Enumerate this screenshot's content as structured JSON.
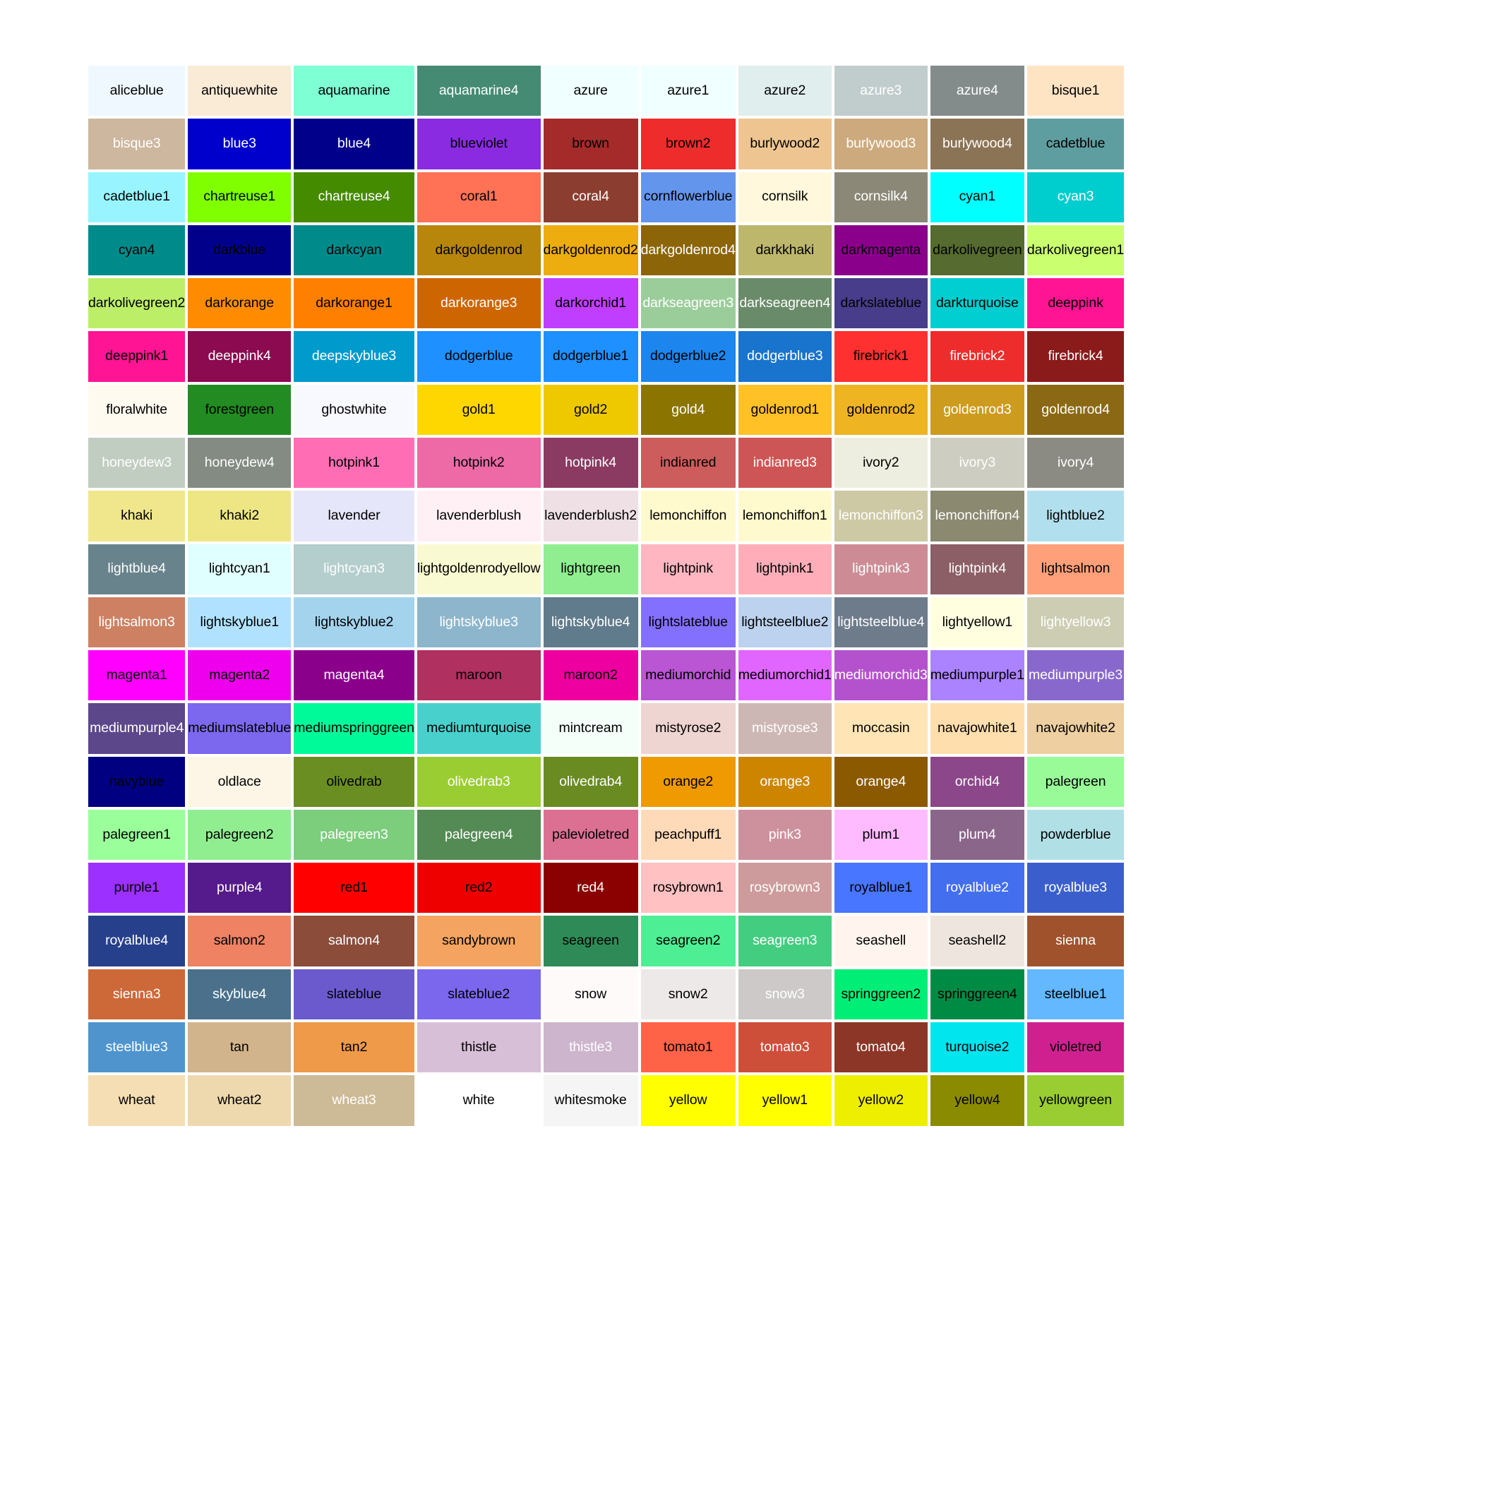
{
  "figure": {
    "type": "color-swatch-grid",
    "background": "#ffffff",
    "columns": 10,
    "rows": 25,
    "total_swatches": 250,
    "gap_color": "#ffffff"
  },
  "chart_data": {
    "type": "table",
    "title": "",
    "xlabel": "",
    "ylabel": "",
    "columns": 10,
    "rows": 25,
    "swatches": [
      {
        "name": "aliceblue",
        "hex": "#f0f8ff",
        "text": "#000000"
      },
      {
        "name": "antiquewhite",
        "hex": "#faebd7",
        "text": "#000000"
      },
      {
        "name": "aquamarine",
        "hex": "#7fffd4",
        "text": "#000000"
      },
      {
        "name": "aquamarine4",
        "hex": "#458b74",
        "text": "#ffffff"
      },
      {
        "name": "azure",
        "hex": "#f0ffff",
        "text": "#000000"
      },
      {
        "name": "azure1",
        "hex": "#f0ffff",
        "text": "#000000"
      },
      {
        "name": "azure2",
        "hex": "#e0eeee",
        "text": "#000000"
      },
      {
        "name": "azure3",
        "hex": "#c1cdcd",
        "text": "#ffffff"
      },
      {
        "name": "azure4",
        "hex": "#838b8b",
        "text": "#ffffff"
      },
      {
        "name": "bisque1",
        "hex": "#ffe4c4",
        "text": "#000000"
      },
      {
        "name": "bisque3",
        "hex": "#cdb79e",
        "text": "#ffffff"
      },
      {
        "name": "blue3",
        "hex": "#0000cd",
        "text": "#ffffff"
      },
      {
        "name": "blue4",
        "hex": "#00008b",
        "text": "#ffffff"
      },
      {
        "name": "blueviolet",
        "hex": "#8a2be2",
        "text": "#000000"
      },
      {
        "name": "brown",
        "hex": "#a52a2a",
        "text": "#000000"
      },
      {
        "name": "brown2",
        "hex": "#ee2c2c",
        "text": "#000000"
      },
      {
        "name": "burlywood2",
        "hex": "#eec591",
        "text": "#000000"
      },
      {
        "name": "burlywood3",
        "hex": "#cdaa7d",
        "text": "#ffffff"
      },
      {
        "name": "burlywood4",
        "hex": "#8b7355",
        "text": "#ffffff"
      },
      {
        "name": "cadetblue",
        "hex": "#5f9ea0",
        "text": "#000000"
      },
      {
        "name": "cadetblue1",
        "hex": "#98f5ff",
        "text": "#000000"
      },
      {
        "name": "chartreuse1",
        "hex": "#7fff00",
        "text": "#000000"
      },
      {
        "name": "chartreuse4",
        "hex": "#458b00",
        "text": "#ffffff"
      },
      {
        "name": "coral1",
        "hex": "#ff7256",
        "text": "#000000"
      },
      {
        "name": "coral4",
        "hex": "#8b3e2f",
        "text": "#ffffff"
      },
      {
        "name": "cornflowerblue",
        "hex": "#6495ed",
        "text": "#000000"
      },
      {
        "name": "cornsilk",
        "hex": "#fff8dc",
        "text": "#000000"
      },
      {
        "name": "cornsilk4",
        "hex": "#8b8878",
        "text": "#ffffff"
      },
      {
        "name": "cyan1",
        "hex": "#00ffff",
        "text": "#000000"
      },
      {
        "name": "cyan3",
        "hex": "#00cdcd",
        "text": "#ffffff"
      },
      {
        "name": "cyan4",
        "hex": "#008b8b",
        "text": "#000000"
      },
      {
        "name": "darkblue",
        "hex": "#00008b",
        "text": "#000000"
      },
      {
        "name": "darkcyan",
        "hex": "#008b8b",
        "text": "#000000"
      },
      {
        "name": "darkgoldenrod",
        "hex": "#b8860b",
        "text": "#000000"
      },
      {
        "name": "darkgoldenrod2",
        "hex": "#eead0e",
        "text": "#000000"
      },
      {
        "name": "darkgoldenrod4",
        "hex": "#8b6508",
        "text": "#ffffff"
      },
      {
        "name": "darkkhaki",
        "hex": "#bdb76b",
        "text": "#000000"
      },
      {
        "name": "darkmagenta",
        "hex": "#8b008b",
        "text": "#000000"
      },
      {
        "name": "darkolivegreen",
        "hex": "#556b2f",
        "text": "#000000"
      },
      {
        "name": "darkolivegreen1",
        "hex": "#caff70",
        "text": "#000000"
      },
      {
        "name": "darkolivegreen2",
        "hex": "#bcee68",
        "text": "#000000"
      },
      {
        "name": "darkorange",
        "hex": "#ff8c00",
        "text": "#000000"
      },
      {
        "name": "darkorange1",
        "hex": "#ff7f00",
        "text": "#000000"
      },
      {
        "name": "darkorange3",
        "hex": "#cd6600",
        "text": "#ffffff"
      },
      {
        "name": "darkorchid1",
        "hex": "#bf3eff",
        "text": "#000000"
      },
      {
        "name": "darkseagreen3",
        "hex": "#9bcd9b",
        "text": "#ffffff"
      },
      {
        "name": "darkseagreen4",
        "hex": "#698b69",
        "text": "#ffffff"
      },
      {
        "name": "darkslateblue",
        "hex": "#483d8b",
        "text": "#000000"
      },
      {
        "name": "darkturquoise",
        "hex": "#00ced1",
        "text": "#000000"
      },
      {
        "name": "deeppink",
        "hex": "#ff1493",
        "text": "#000000"
      },
      {
        "name": "deeppink1",
        "hex": "#ff1493",
        "text": "#000000"
      },
      {
        "name": "deeppink4",
        "hex": "#8b0a50",
        "text": "#ffffff"
      },
      {
        "name": "deepskyblue3",
        "hex": "#009acd",
        "text": "#ffffff"
      },
      {
        "name": "dodgerblue",
        "hex": "#1e90ff",
        "text": "#000000"
      },
      {
        "name": "dodgerblue1",
        "hex": "#1e90ff",
        "text": "#000000"
      },
      {
        "name": "dodgerblue2",
        "hex": "#1c86ee",
        "text": "#000000"
      },
      {
        "name": "dodgerblue3",
        "hex": "#1874cd",
        "text": "#ffffff"
      },
      {
        "name": "firebrick1",
        "hex": "#ff3030",
        "text": "#000000"
      },
      {
        "name": "firebrick2",
        "hex": "#ee2c2c",
        "text": "#ffffff"
      },
      {
        "name": "firebrick4",
        "hex": "#8b1a1a",
        "text": "#ffffff"
      },
      {
        "name": "floralwhite",
        "hex": "#fffaf0",
        "text": "#000000"
      },
      {
        "name": "forestgreen",
        "hex": "#228b22",
        "text": "#000000"
      },
      {
        "name": "ghostwhite",
        "hex": "#f8f8ff",
        "text": "#000000"
      },
      {
        "name": "gold1",
        "hex": "#ffd700",
        "text": "#000000"
      },
      {
        "name": "gold2",
        "hex": "#eec900",
        "text": "#000000"
      },
      {
        "name": "gold4",
        "hex": "#8b7500",
        "text": "#ffffff"
      },
      {
        "name": "goldenrod1",
        "hex": "#ffc125",
        "text": "#000000"
      },
      {
        "name": "goldenrod2",
        "hex": "#eeb422",
        "text": "#000000"
      },
      {
        "name": "goldenrod3",
        "hex": "#cd9b1d",
        "text": "#ffffff"
      },
      {
        "name": "goldenrod4",
        "hex": "#8b6914",
        "text": "#ffffff"
      },
      {
        "name": "honeydew3",
        "hex": "#c1cdc1",
        "text": "#ffffff"
      },
      {
        "name": "honeydew4",
        "hex": "#838b83",
        "text": "#ffffff"
      },
      {
        "name": "hotpink1",
        "hex": "#ff6eb4",
        "text": "#000000"
      },
      {
        "name": "hotpink2",
        "hex": "#ee6aa7",
        "text": "#000000"
      },
      {
        "name": "hotpink4",
        "hex": "#8b3a62",
        "text": "#ffffff"
      },
      {
        "name": "indianred",
        "hex": "#cd5c5c",
        "text": "#000000"
      },
      {
        "name": "indianred3",
        "hex": "#cd5555",
        "text": "#ffffff"
      },
      {
        "name": "ivory2",
        "hex": "#eeeee0",
        "text": "#000000"
      },
      {
        "name": "ivory3",
        "hex": "#cdcdc1",
        "text": "#ffffff"
      },
      {
        "name": "ivory4",
        "hex": "#8b8b83",
        "text": "#ffffff"
      },
      {
        "name": "khaki",
        "hex": "#f0e68c",
        "text": "#000000"
      },
      {
        "name": "khaki2",
        "hex": "#eee685",
        "text": "#000000"
      },
      {
        "name": "lavender",
        "hex": "#e6e6fa",
        "text": "#000000"
      },
      {
        "name": "lavenderblush",
        "hex": "#fff0f5",
        "text": "#000000"
      },
      {
        "name": "lavenderblush2",
        "hex": "#eee0e5",
        "text": "#000000"
      },
      {
        "name": "lemonchiffon",
        "hex": "#fffacd",
        "text": "#000000"
      },
      {
        "name": "lemonchiffon1",
        "hex": "#fffacd",
        "text": "#000000"
      },
      {
        "name": "lemonchiffon3",
        "hex": "#cdc9a5",
        "text": "#ffffff"
      },
      {
        "name": "lemonchiffon4",
        "hex": "#8b8970",
        "text": "#ffffff"
      },
      {
        "name": "lightblue2",
        "hex": "#b2dfee",
        "text": "#000000"
      },
      {
        "name": "lightblue4",
        "hex": "#68838b",
        "text": "#ffffff"
      },
      {
        "name": "lightcyan1",
        "hex": "#e0ffff",
        "text": "#000000"
      },
      {
        "name": "lightcyan3",
        "hex": "#b4cdcd",
        "text": "#ffffff"
      },
      {
        "name": "lightgoldenrodyellow",
        "hex": "#fafad2",
        "text": "#000000"
      },
      {
        "name": "lightgreen",
        "hex": "#90ee90",
        "text": "#000000"
      },
      {
        "name": "lightpink",
        "hex": "#ffb6c1",
        "text": "#000000"
      },
      {
        "name": "lightpink1",
        "hex": "#ffaeb9",
        "text": "#000000"
      },
      {
        "name": "lightpink3",
        "hex": "#cd8c95",
        "text": "#ffffff"
      },
      {
        "name": "lightpink4",
        "hex": "#8b5f65",
        "text": "#ffffff"
      },
      {
        "name": "lightsalmon",
        "hex": "#ffa07a",
        "text": "#000000"
      },
      {
        "name": "lightsalmon3",
        "hex": "#cd8162",
        "text": "#ffffff"
      },
      {
        "name": "lightskyblue1",
        "hex": "#b0e2ff",
        "text": "#000000"
      },
      {
        "name": "lightskyblue2",
        "hex": "#a4d3ee",
        "text": "#000000"
      },
      {
        "name": "lightskyblue3",
        "hex": "#8db6cd",
        "text": "#ffffff"
      },
      {
        "name": "lightskyblue4",
        "hex": "#607b8b",
        "text": "#ffffff"
      },
      {
        "name": "lightslateblue",
        "hex": "#8470ff",
        "text": "#000000"
      },
      {
        "name": "lightsteelblue2",
        "hex": "#bcd2ee",
        "text": "#000000"
      },
      {
        "name": "lightsteelblue4",
        "hex": "#6e7b8b",
        "text": "#ffffff"
      },
      {
        "name": "lightyellow1",
        "hex": "#ffffe0",
        "text": "#000000"
      },
      {
        "name": "lightyellow3",
        "hex": "#cdcdb4",
        "text": "#ffffff"
      },
      {
        "name": "magenta1",
        "hex": "#ff00ff",
        "text": "#000000"
      },
      {
        "name": "magenta2",
        "hex": "#ee00ee",
        "text": "#000000"
      },
      {
        "name": "magenta4",
        "hex": "#8b008b",
        "text": "#ffffff"
      },
      {
        "name": "maroon",
        "hex": "#b03060",
        "text": "#000000"
      },
      {
        "name": "maroon2",
        "hex": "#ee00a0",
        "text": "#000000"
      },
      {
        "name": "mediumorchid",
        "hex": "#ba55d3",
        "text": "#000000"
      },
      {
        "name": "mediumorchid1",
        "hex": "#e066ff",
        "text": "#000000"
      },
      {
        "name": "mediumorchid3",
        "hex": "#b452cd",
        "text": "#ffffff"
      },
      {
        "name": "mediumpurple1",
        "hex": "#ab82ff",
        "text": "#000000"
      },
      {
        "name": "mediumpurple3",
        "hex": "#8968cd",
        "text": "#ffffff"
      },
      {
        "name": "mediumpurple4",
        "hex": "#5d478b",
        "text": "#ffffff"
      },
      {
        "name": "mediumslateblue",
        "hex": "#7b68ee",
        "text": "#000000"
      },
      {
        "name": "mediumspringgreen",
        "hex": "#00fa9a",
        "text": "#000000"
      },
      {
        "name": "mediumturquoise",
        "hex": "#48d1cc",
        "text": "#000000"
      },
      {
        "name": "mintcream",
        "hex": "#f5fffa",
        "text": "#000000"
      },
      {
        "name": "mistyrose2",
        "hex": "#eed5d2",
        "text": "#000000"
      },
      {
        "name": "mistyrose3",
        "hex": "#cdb7b5",
        "text": "#ffffff"
      },
      {
        "name": "moccasin",
        "hex": "#ffe4b5",
        "text": "#000000"
      },
      {
        "name": "navajowhite1",
        "hex": "#ffdead",
        "text": "#000000"
      },
      {
        "name": "navajowhite2",
        "hex": "#eecfa1",
        "text": "#000000"
      },
      {
        "name": "navyblue",
        "hex": "#000080",
        "text": "#000000"
      },
      {
        "name": "oldlace",
        "hex": "#fdf5e6",
        "text": "#000000"
      },
      {
        "name": "olivedrab",
        "hex": "#6b8e23",
        "text": "#000000"
      },
      {
        "name": "olivedrab3",
        "hex": "#9acd32",
        "text": "#ffffff"
      },
      {
        "name": "olivedrab4",
        "hex": "#698b22",
        "text": "#ffffff"
      },
      {
        "name": "orange2",
        "hex": "#ee9a00",
        "text": "#000000"
      },
      {
        "name": "orange3",
        "hex": "#cd8500",
        "text": "#ffffff"
      },
      {
        "name": "orange4",
        "hex": "#8b5a00",
        "text": "#ffffff"
      },
      {
        "name": "orchid4",
        "hex": "#8b4789",
        "text": "#ffffff"
      },
      {
        "name": "palegreen",
        "hex": "#98fb98",
        "text": "#000000"
      },
      {
        "name": "palegreen1",
        "hex": "#9aff9a",
        "text": "#000000"
      },
      {
        "name": "palegreen2",
        "hex": "#90ee90",
        "text": "#000000"
      },
      {
        "name": "palegreen3",
        "hex": "#7ccd7c",
        "text": "#ffffff"
      },
      {
        "name": "palegreen4",
        "hex": "#548b54",
        "text": "#ffffff"
      },
      {
        "name": "palevioletred",
        "hex": "#db7093",
        "text": "#000000"
      },
      {
        "name": "peachpuff1",
        "hex": "#ffdab9",
        "text": "#000000"
      },
      {
        "name": "pink3",
        "hex": "#cd919e",
        "text": "#ffffff"
      },
      {
        "name": "plum1",
        "hex": "#ffbbff",
        "text": "#000000"
      },
      {
        "name": "plum4",
        "hex": "#8b668b",
        "text": "#ffffff"
      },
      {
        "name": "powderblue",
        "hex": "#b0e0e6",
        "text": "#000000"
      },
      {
        "name": "purple1",
        "hex": "#9b30ff",
        "text": "#000000"
      },
      {
        "name": "purple4",
        "hex": "#551a8b",
        "text": "#ffffff"
      },
      {
        "name": "red1",
        "hex": "#ff0000",
        "text": "#000000"
      },
      {
        "name": "red2",
        "hex": "#ee0000",
        "text": "#000000"
      },
      {
        "name": "red4",
        "hex": "#8b0000",
        "text": "#ffffff"
      },
      {
        "name": "rosybrown1",
        "hex": "#ffc1c1",
        "text": "#000000"
      },
      {
        "name": "rosybrown3",
        "hex": "#cd9b9b",
        "text": "#ffffff"
      },
      {
        "name": "royalblue1",
        "hex": "#4876ff",
        "text": "#000000"
      },
      {
        "name": "royalblue2",
        "hex": "#436eee",
        "text": "#ffffff"
      },
      {
        "name": "royalblue3",
        "hex": "#3a5fcd",
        "text": "#ffffff"
      },
      {
        "name": "royalblue4",
        "hex": "#27408b",
        "text": "#ffffff"
      },
      {
        "name": "salmon2",
        "hex": "#ee8262",
        "text": "#000000"
      },
      {
        "name": "salmon4",
        "hex": "#8b4c39",
        "text": "#ffffff"
      },
      {
        "name": "sandybrown",
        "hex": "#f4a460",
        "text": "#000000"
      },
      {
        "name": "seagreen",
        "hex": "#2e8b57",
        "text": "#000000"
      },
      {
        "name": "seagreen2",
        "hex": "#4eee94",
        "text": "#000000"
      },
      {
        "name": "seagreen3",
        "hex": "#43cd80",
        "text": "#ffffff"
      },
      {
        "name": "seashell",
        "hex": "#fff5ee",
        "text": "#000000"
      },
      {
        "name": "seashell2",
        "hex": "#eee5de",
        "text": "#000000"
      },
      {
        "name": "sienna",
        "hex": "#a0522d",
        "text": "#ffffff"
      },
      {
        "name": "sienna3",
        "hex": "#cd6839",
        "text": "#ffffff"
      },
      {
        "name": "skyblue4",
        "hex": "#4a708b",
        "text": "#ffffff"
      },
      {
        "name": "slateblue",
        "hex": "#6a5acd",
        "text": "#000000"
      },
      {
        "name": "slateblue2",
        "hex": "#7a67ee",
        "text": "#000000"
      },
      {
        "name": "snow",
        "hex": "#fffafa",
        "text": "#000000"
      },
      {
        "name": "snow2",
        "hex": "#eee9e9",
        "text": "#000000"
      },
      {
        "name": "snow3",
        "hex": "#cdc9c9",
        "text": "#ffffff"
      },
      {
        "name": "springgreen2",
        "hex": "#00ee76",
        "text": "#000000"
      },
      {
        "name": "springgreen4",
        "hex": "#008b45",
        "text": "#000000"
      },
      {
        "name": "steelblue1",
        "hex": "#63b8ff",
        "text": "#000000"
      },
      {
        "name": "steelblue3",
        "hex": "#4f94cd",
        "text": "#ffffff"
      },
      {
        "name": "tan",
        "hex": "#d2b48c",
        "text": "#000000"
      },
      {
        "name": "tan2",
        "hex": "#ee9a49",
        "text": "#000000"
      },
      {
        "name": "thistle",
        "hex": "#d8bfd8",
        "text": "#000000"
      },
      {
        "name": "thistle3",
        "hex": "#cdb5cd",
        "text": "#ffffff"
      },
      {
        "name": "tomato1",
        "hex": "#ff6347",
        "text": "#000000"
      },
      {
        "name": "tomato3",
        "hex": "#cd4f39",
        "text": "#ffffff"
      },
      {
        "name": "tomato4",
        "hex": "#8b3626",
        "text": "#ffffff"
      },
      {
        "name": "turquoise2",
        "hex": "#00e5ee",
        "text": "#000000"
      },
      {
        "name": "violetred",
        "hex": "#d02090",
        "text": "#000000"
      },
      {
        "name": "wheat",
        "hex": "#f5deb3",
        "text": "#000000"
      },
      {
        "name": "wheat2",
        "hex": "#eed8ae",
        "text": "#000000"
      },
      {
        "name": "wheat3",
        "hex": "#cdba96",
        "text": "#ffffff"
      },
      {
        "name": "white",
        "hex": "#ffffff",
        "text": "#000000"
      },
      {
        "name": "whitesmoke",
        "hex": "#f5f5f5",
        "text": "#000000"
      },
      {
        "name": "yellow",
        "hex": "#ffff00",
        "text": "#000000"
      },
      {
        "name": "yellow1",
        "hex": "#ffff00",
        "text": "#000000"
      },
      {
        "name": "yellow2",
        "hex": "#eeee00",
        "text": "#000000"
      },
      {
        "name": "yellow4",
        "hex": "#8b8b00",
        "text": "#000000"
      },
      {
        "name": "yellowgreen",
        "hex": "#9acd32",
        "text": "#000000"
      }
    ]
  }
}
